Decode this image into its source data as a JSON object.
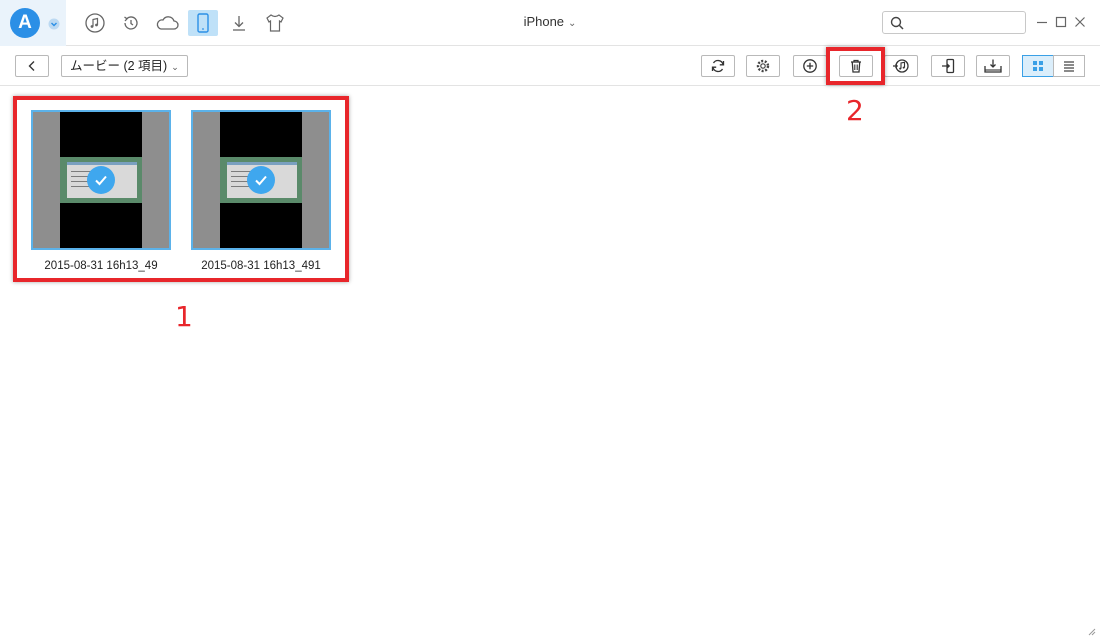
{
  "app": {
    "logo_letter": "A",
    "device_name": "iPhone",
    "accent_color": "#2b8fe6"
  },
  "topbar": {
    "icons": [
      "music-icon",
      "backup-restore-icon",
      "cloud-icon",
      "device-icon",
      "download-icon",
      "shirt-icon"
    ],
    "active_icon": "device-icon",
    "search": {
      "placeholder": "",
      "value": ""
    }
  },
  "toolbar": {
    "breadcrumb": "ムービー (2 項目)",
    "buttons": [
      "refresh-icon",
      "settings-icon",
      "add-icon",
      "delete-icon",
      "to-itunes-icon",
      "to-device-icon",
      "to-computer-icon"
    ],
    "view_mode": "grid"
  },
  "items": [
    {
      "name": "2015-08-31 16h13_49",
      "selected": true
    },
    {
      "name": "2015-08-31 16h13_491",
      "selected": true
    }
  ],
  "annotations": {
    "step1": "1",
    "step2": "2",
    "color": "#e8262b"
  }
}
